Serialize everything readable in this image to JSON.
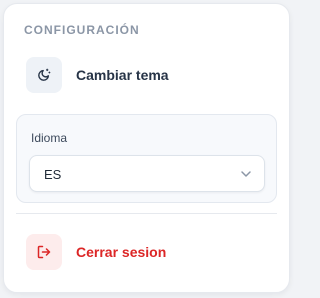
{
  "settings_menu": {
    "section_title": "CONFIGURACIÓN",
    "theme": {
      "label": "Cambiar tema",
      "icon": "theme-toggle-icon"
    },
    "language": {
      "label": "Idioma",
      "selected": "ES",
      "icon": "chevron-down-icon"
    },
    "logout": {
      "label": "Cerrar sesion",
      "icon": "logout-icon"
    }
  },
  "colors": {
    "section_title": "#8b96a6",
    "text_primary": "#273447",
    "danger": "#dc2626",
    "danger_bg": "#fdecec",
    "neutral_icon_bg": "#eef2f7",
    "panel_bg": "#f7f9fc"
  }
}
